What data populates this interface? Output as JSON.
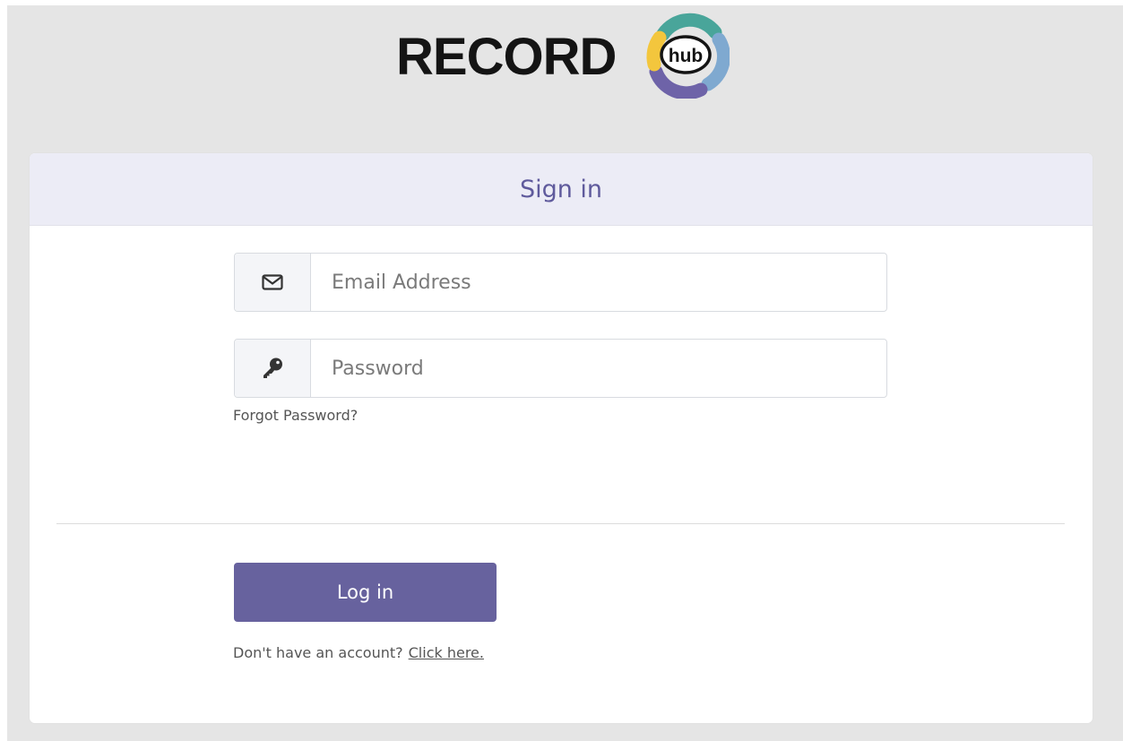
{
  "logo": {
    "wordmark": "RECORD",
    "badge": "hub",
    "colors": {
      "teal": "#49a59a",
      "yellow": "#f3c63d",
      "purple": "#6e63a8",
      "blue": "#7fa9d0"
    }
  },
  "card": {
    "title": "Sign in"
  },
  "form": {
    "email": {
      "icon": "envelope-icon",
      "placeholder": "Email Address",
      "value": ""
    },
    "password": {
      "icon": "key-icon",
      "placeholder": "Password",
      "value": ""
    },
    "forgot_label": "Forgot Password?",
    "login_label": "Log in",
    "signup_prompt": "Don't have an account?",
    "signup_link": "Click here."
  },
  "colors": {
    "page_background": "#e5e5e5",
    "header_background": "#ececf6",
    "title_text": "#5f5a9c",
    "button_background": "#67629e"
  }
}
